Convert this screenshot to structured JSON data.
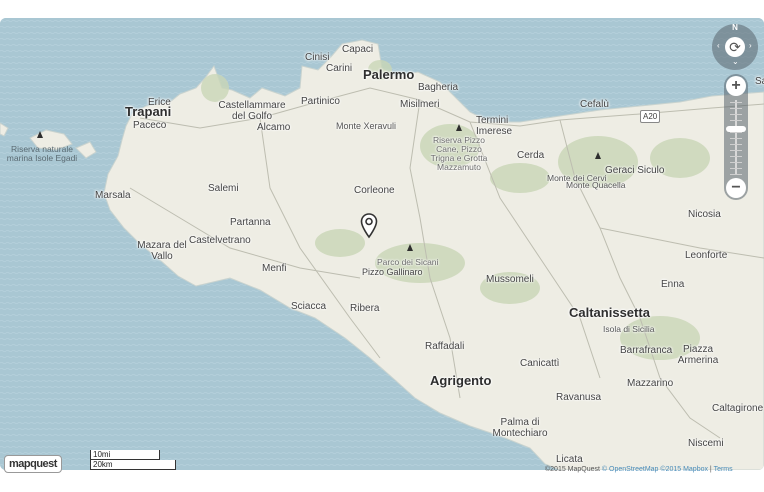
{
  "map": {
    "cities": [
      "Palermo",
      "Trapani",
      "Caltanissetta",
      "Agrigento"
    ],
    "towns": [
      "Capaci",
      "Cinisi",
      "Carini",
      "Bagheria",
      "Misilmeri",
      "Termini Imerese",
      "Cefalù",
      "Partinico",
      "Castellammare del Golfo",
      "Alcamo",
      "Erice",
      "Paceco",
      "Monte Xeravuli",
      "Cerda",
      "Marsala",
      "Salemi",
      "Corleone",
      "Partanna",
      "Castelvetrano",
      "Mazara del Vallo",
      "Menfi",
      "Sciacca",
      "Ribera",
      "Mussomeli",
      "Raffadali",
      "Canicattì",
      "Ravanusa",
      "Palma di Montechiaro",
      "Licata",
      "Nicosia",
      "Leonforte",
      "Enna",
      "Barrafranca",
      "Piazza Armerina",
      "Mazzarino",
      "Caltagirone",
      "Niscemi",
      "Geraci Siculo",
      "Monte dei Cervi",
      "Monte Quacella",
      "Isola di Sicilia"
    ],
    "parks": [
      "Riserva Pizzo Cane, Pizzo Trigna e Grotta Mazzamuto",
      "Parco dei Sicani",
      "Pizzo Gallinaro",
      "Riserva naturale marina Isole Egadi"
    ],
    "road_shield": "A20",
    "edge_label": "Sa"
  },
  "controls": {
    "compass_north": "N",
    "zoom_in": "+",
    "zoom_out": "−",
    "zoom_level": 0.62
  },
  "footer": {
    "logo": "mapquest",
    "scale_mi": "10mi",
    "scale_km": "20km",
    "attribution_copy": "©2015 MapQuest",
    "attribution_osm": "© OpenStreetMap",
    "attribution_mapbox": "©2015 Mapbox",
    "attribution_terms": "Terms"
  }
}
